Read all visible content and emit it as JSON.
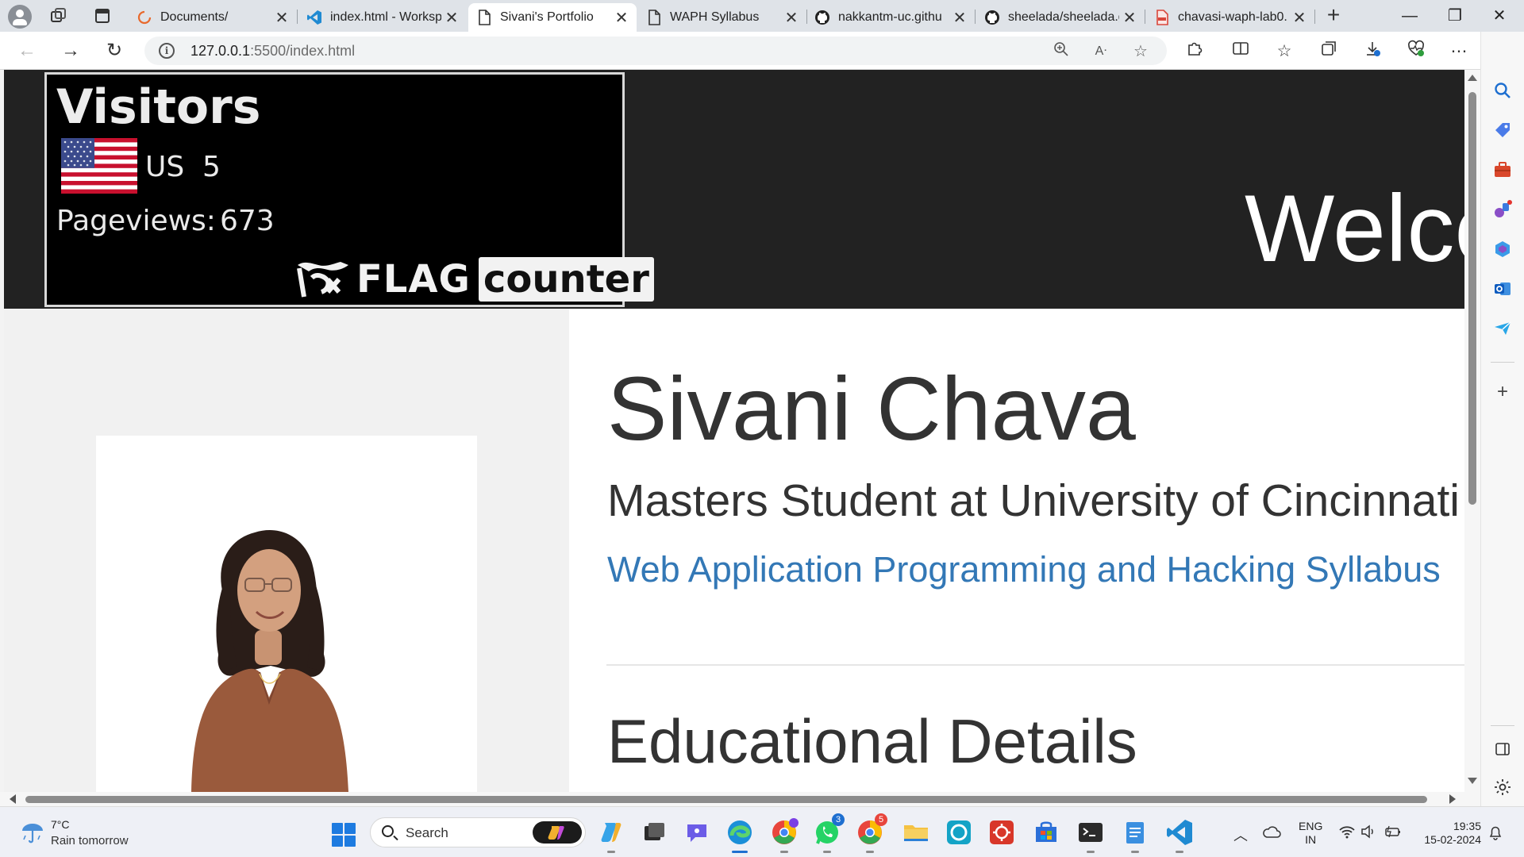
{
  "browser": {
    "tabs": [
      {
        "title": "Documents/",
        "icon": "loading-spinner-icon",
        "active": false
      },
      {
        "title": "index.html - Worksp",
        "icon": "vscode-icon",
        "active": false
      },
      {
        "title": "Sivani's Portfolio",
        "icon": "page-icon",
        "active": true
      },
      {
        "title": "WAPH Syllabus",
        "icon": "page-icon",
        "active": false
      },
      {
        "title": "nakkantm-uc.githu",
        "icon": "github-icon",
        "active": false
      },
      {
        "title": "sheelada/sheelada.g",
        "icon": "github-icon",
        "active": false
      },
      {
        "title": "chavasi-waph-lab0.",
        "icon": "pdf-icon",
        "active": false
      }
    ],
    "close_glyph": "✕",
    "new_tab_glyph": "+",
    "address": {
      "host": "127.0.0.1",
      "rest": ":5500/index.html"
    },
    "window_controls": {
      "minimize": "—",
      "restore": "❐",
      "close": "✕"
    }
  },
  "page": {
    "flag_counter": {
      "title": "Visitors",
      "country": "US",
      "country_count": "5",
      "pageviews_label": "Pageviews:",
      "pageviews_value": "673",
      "brand_flag": "FLAG",
      "brand_counter": "counter"
    },
    "welcome": "Welco",
    "name": "Sivani Chava",
    "subtitle": "Masters Student at University of Cincinnati",
    "syllabus_link": "Web Application Programming and Hacking Syllabus",
    "section_heading": "Educational Details"
  },
  "taskbar": {
    "weather": {
      "temp": "7°C",
      "desc": "Rain tomorrow"
    },
    "search_label": "Search",
    "whatsapp_badge": "3",
    "chrome_badge": "5",
    "lang": [
      "ENG",
      "IN"
    ],
    "time": "19:35",
    "date": "15-02-2024"
  },
  "colors": {
    "link_blue": "#3378b6",
    "hero_bg": "#222222",
    "accent": "#1e6fd0"
  }
}
